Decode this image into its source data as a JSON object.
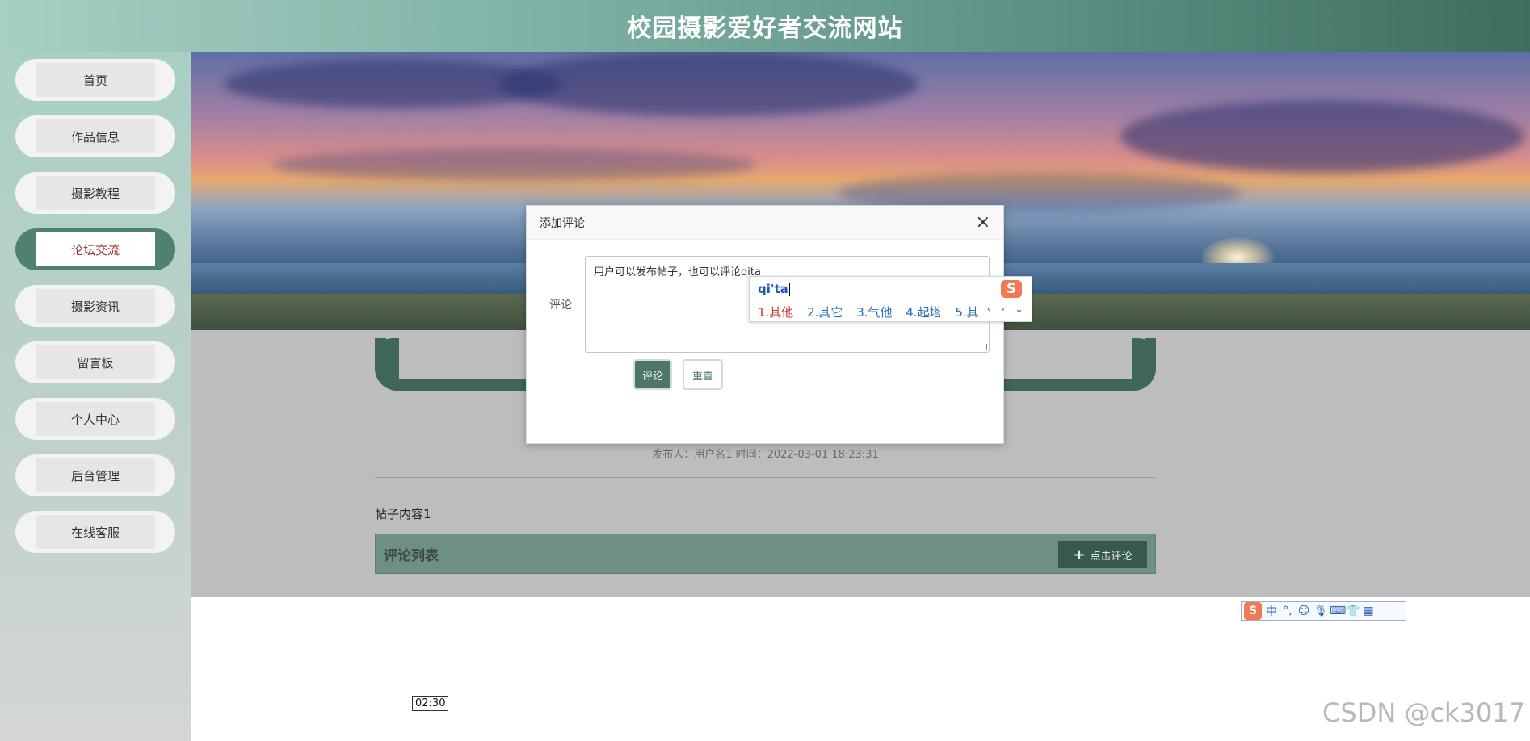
{
  "site": {
    "title": "校园摄影爱好者交流网站"
  },
  "nav": {
    "items": [
      {
        "label": "首页"
      },
      {
        "label": "作品信息"
      },
      {
        "label": "摄影教程"
      },
      {
        "label": "论坛交流",
        "active": true
      },
      {
        "label": "摄影资讯"
      },
      {
        "label": "留言板"
      },
      {
        "label": "个人中心"
      },
      {
        "label": "后台管理"
      },
      {
        "label": "在线客服"
      }
    ]
  },
  "post": {
    "meta": "发布人：用户名1 时间：2022-03-01 18:23:31",
    "content": "帖子内容1",
    "comment_list_label": "评论列表",
    "add_comment_label": "点击评论"
  },
  "dialog": {
    "title": "添加评论",
    "close_label": "×",
    "field_label": "评论",
    "textarea_value": "用户可以发布帖子，也可以评论qita",
    "submit_label": "评论",
    "reset_label": "重置"
  },
  "ime": {
    "pinyin": "qi'ta",
    "logo": "S",
    "candidates": [
      "1.其他",
      "2.其它",
      "3.气他",
      "4.起塔",
      "5.其"
    ],
    "nav_glyphs": "‹ › ⌄",
    "toolbar": [
      "中",
      "°,",
      "☺",
      "🎙",
      "⌨",
      "👕",
      "▦"
    ]
  },
  "timer": "02:30",
  "watermark": "CSDN @ck3017",
  "colors": {
    "accent": "#4f8070",
    "active_text": "#9c3030",
    "dark_bar": "#3f6659"
  }
}
